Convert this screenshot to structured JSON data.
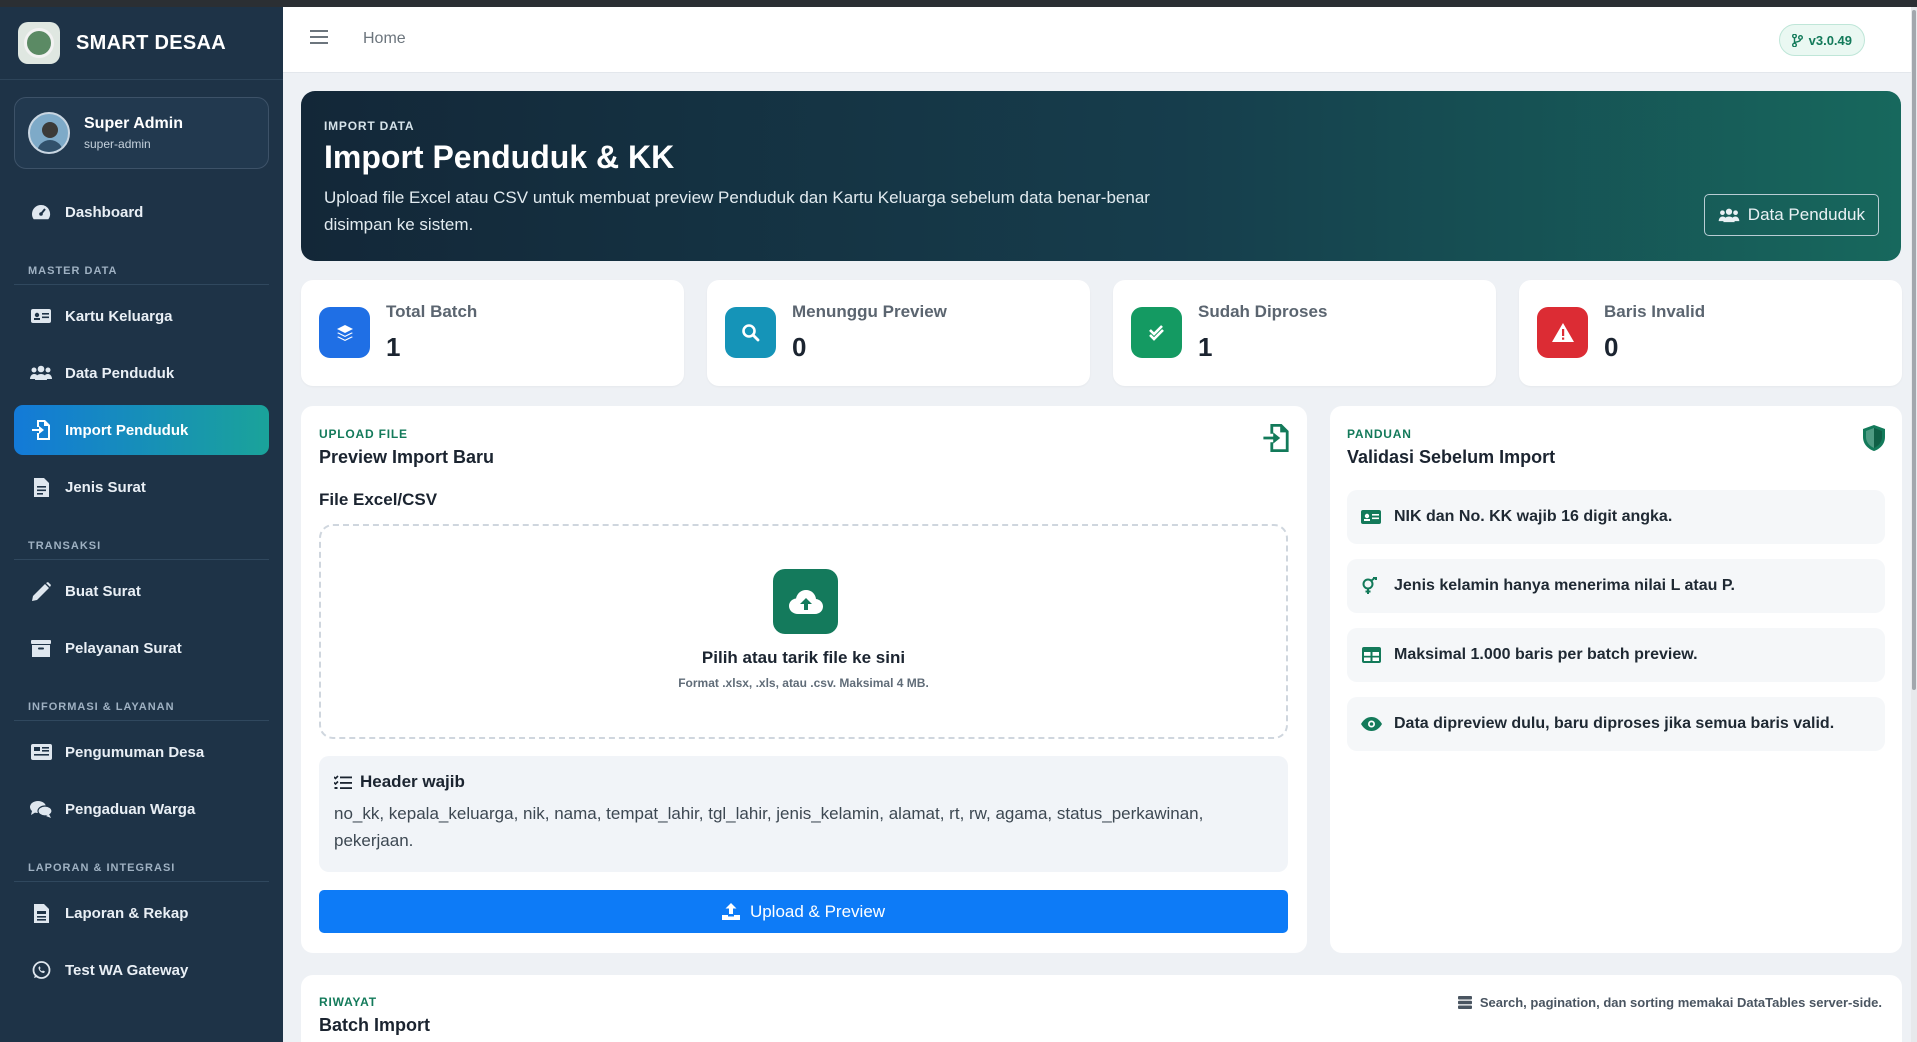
{
  "app": {
    "brand_name": "SMART DESAA"
  },
  "user": {
    "name": "Super Admin",
    "role": "super-admin"
  },
  "sidebar": {
    "dashboard": "Dashboard",
    "sections": {
      "master": "MASTER DATA",
      "transaksi": "TRANSAKSI",
      "informasi": "INFORMASI & LAYANAN",
      "laporan": "LAPORAN & INTEGRASI"
    },
    "items": {
      "kartu_keluarga": "Kartu Keluarga",
      "data_penduduk": "Data Penduduk",
      "import_penduduk": "Import Penduduk",
      "jenis_surat": "Jenis Surat",
      "buat_surat": "Buat Surat",
      "pelayanan_surat": "Pelayanan Surat",
      "pengumuman_desa": "Pengumuman Desa",
      "pengaduan_warga": "Pengaduan Warga",
      "laporan_rekap": "Laporan & Rekap",
      "test_wa": "Test WA Gateway"
    },
    "active_item": "Import Penduduk"
  },
  "topbar": {
    "breadcrumb": "Home",
    "version": "v3.0.49"
  },
  "hero": {
    "eyebrow": "IMPORT DATA",
    "title": "Import Penduduk & KK",
    "description": "Upload file Excel atau CSV untuk membuat preview Penduduk dan Kartu Keluarga sebelum data benar-benar disimpan ke sistem.",
    "button": "Data Penduduk"
  },
  "stats": [
    {
      "label": "Total Batch",
      "value": "1",
      "color": "#1f6fe5"
    },
    {
      "label": "Menunggu Preview",
      "value": "0",
      "color": "#1594b8"
    },
    {
      "label": "Sudah Diproses",
      "value": "1",
      "color": "#149a62"
    },
    {
      "label": "Baris Invalid",
      "value": "0",
      "color": "#dc2c34"
    }
  ],
  "upload": {
    "eyebrow": "UPLOAD FILE",
    "title": "Preview Import Baru",
    "field_label": "File Excel/CSV",
    "drop_title": "Pilih atau tarik file ke sini",
    "drop_hint": "Format .xlsx, .xls, atau .csv. Maksimal 4 MB.",
    "header_title": "Header wajib",
    "header_fields": "no_kk, kepala_keluarga, nik, nama, tempat_lahir, tgl_lahir, jenis_kelamin, alamat, rt, rw, agama, status_perkawinan, pekerjaan.",
    "button": "Upload & Preview"
  },
  "guide": {
    "eyebrow": "PANDUAN",
    "title": "Validasi Sebelum Import",
    "items": [
      "NIK dan No. KK wajib 16 digit angka.",
      "Jenis kelamin hanya menerima nilai L atau P.",
      "Maksimal 1.000 baris per batch preview.",
      "Data dipreview dulu, baru diproses jika semua baris valid."
    ]
  },
  "history": {
    "eyebrow": "RIWAYAT",
    "title": "Batch Import",
    "note": "Search, pagination, dan sorting memakai DataTables server-side."
  },
  "colors": {
    "accent": "#137a5a",
    "primary": "#0d7bf7",
    "sidebar": "#1e3347"
  }
}
